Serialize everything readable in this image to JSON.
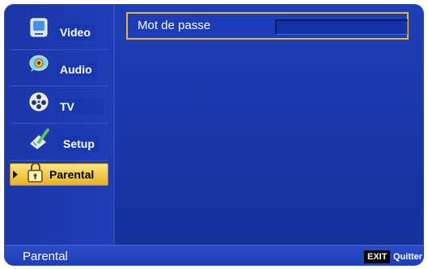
{
  "sidebar": {
    "items": [
      {
        "label": "Video",
        "icon": "video-icon",
        "active": false
      },
      {
        "label": "Audio",
        "icon": "audio-icon",
        "active": false
      },
      {
        "label": "TV",
        "icon": "tv-reel-icon",
        "active": false
      },
      {
        "label": "Setup",
        "icon": "setup-icon",
        "active": false
      },
      {
        "label": "Parental",
        "icon": "parental-icon",
        "active": true
      }
    ]
  },
  "content": {
    "password_label": "Mot de passe",
    "password_value": ""
  },
  "footer": {
    "title": "Parental",
    "exit_key": "EXIT",
    "exit_label": "Quitter"
  },
  "colors": {
    "background": "#1a38aa",
    "highlight": "#f2c640",
    "row_border": "#e3b53a"
  }
}
